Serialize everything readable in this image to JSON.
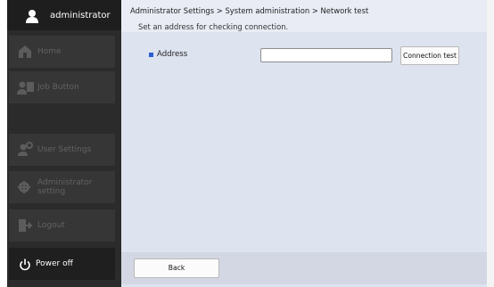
{
  "sidebar": {
    "user": {
      "label": "administrator",
      "icon": "user-icon"
    },
    "items": [
      {
        "label": "Home",
        "icon": "home-icon"
      },
      {
        "label": "Job Button",
        "icon": "job-button-icon"
      },
      {
        "label": "User Settings",
        "icon": "user-settings-icon"
      },
      {
        "label": "Administrator\nsetting",
        "icon": "admin-gear-icon"
      },
      {
        "label": "Logout",
        "icon": "logout-icon"
      }
    ],
    "power": {
      "label": "Power off",
      "icon": "power-icon"
    }
  },
  "main": {
    "breadcrumb": "Administrator Settings > System administration > Network test",
    "description": "Set an address for checking connection.",
    "address_label": "Address",
    "address_value": "",
    "connection_button": "Connection test"
  },
  "footer": {
    "back_button": "Back"
  },
  "colors": {
    "sidebar_bg": "#2b2b2b",
    "sidebar_item_bg": "#363636",
    "sidebar_disabled_text": "#626262",
    "main_bg": "#dde3ef",
    "accent_bullet": "#2a5fd1"
  }
}
